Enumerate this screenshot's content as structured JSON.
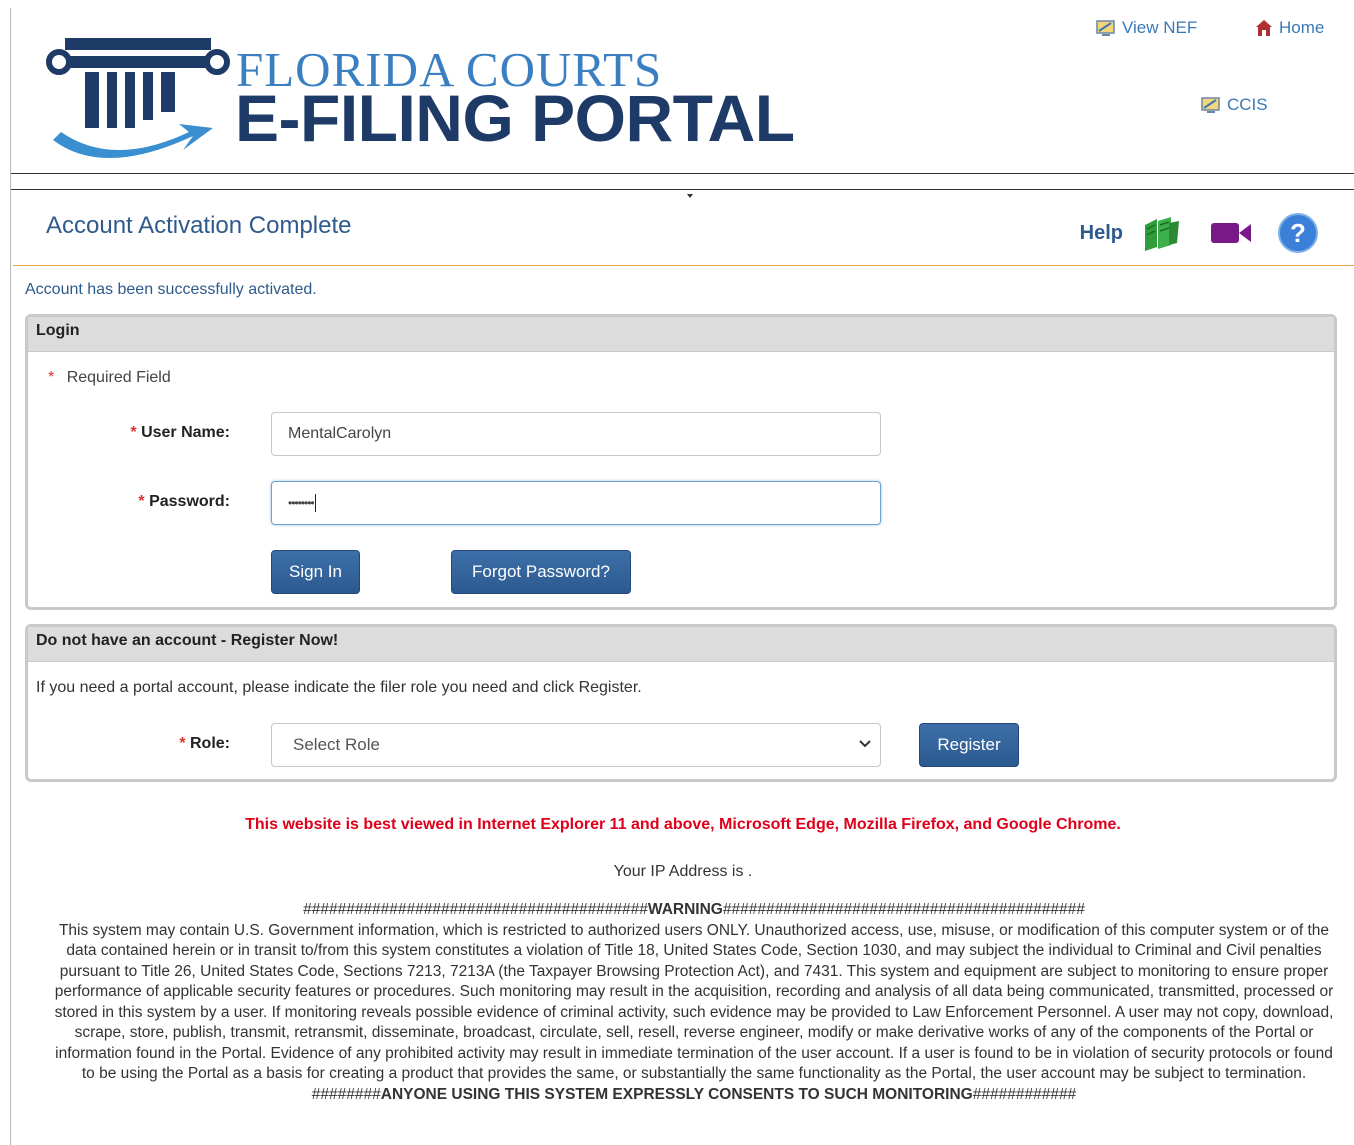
{
  "header": {
    "brand_line1": "FLORIDA COURTS",
    "brand_line2": "E-FILING PORTAL",
    "links": {
      "view_nef": "View NEF",
      "home": "Home",
      "ccis": "CCIS"
    }
  },
  "page": {
    "title": "Account Activation Complete",
    "help_label": "Help",
    "status_message": "Account has been successfully activated."
  },
  "login": {
    "heading": "Login",
    "required_marker": "*",
    "required_note": "Required Field",
    "username_label": "User Name:",
    "username_value": "MentalCarolyn",
    "password_label": "Password:",
    "password_value": "••••••••",
    "sign_in_label": "Sign In",
    "forgot_label": "Forgot Password?"
  },
  "register": {
    "heading": "Do not have an account - Register Now!",
    "instructions": "If you need a portal account, please indicate the filer role you need and click Register.",
    "role_label": "Role:",
    "role_selected": "Select Role",
    "register_label": "Register"
  },
  "footer": {
    "browser_note": "This website is best viewed in Internet Explorer 11 and above, Microsoft Edge, Mozilla Firefox, and Google Chrome.",
    "ip_line": "Your IP Address is .",
    "warning_title_left": "########################################",
    "warning_title_word": "WARNING",
    "warning_title_right": "##########################################",
    "warning_body": "This system may contain U.S. Government information, which is restricted to authorized users ONLY. Unauthorized access, use, misuse, or modification of this computer system or of the data contained herein or in transit to/from this system constitutes a violation of Title 18, United States Code, Section 1030, and may subject the individual to Criminal and Civil penalties pursuant to Title 26, United States Code, Sections 7213, 7213A (the Taxpayer Browsing Protection Act), and 7431. This system and equipment are subject to monitoring to ensure proper performance of applicable security features or procedures. Such monitoring may result in the acquisition, recording and analysis of all data being communicated, transmitted, processed or stored in this system by a user. If monitoring reveals possible evidence of criminal activity, such evidence may be provided to Law Enforcement Personnel. A user may not copy, download, scrape, store, publish, transmit, retransmit, disseminate, broadcast, circulate, sell, resell, reverse engineer, modify or make derivative works of any of the components of the Portal or information found in the Portal. Evidence of any prohibited activity may result in immediate termination of the user account. If a user is found to be in violation of security protocols or found to be using the Portal as a basis for creating a product that provides the same, or substantially the same functionality as the Portal, the user account may be subject to termination.",
    "warning_footer_left": "########",
    "warning_footer_word": "ANYONE USING THIS SYSTEM EXPRESSLY CONSENTS TO SUCH MONITORING",
    "warning_footer_right": "############"
  },
  "colors": {
    "brand_blue": "#3a7fc1",
    "brand_navy": "#1e3a66",
    "button_blue": "#2b5a8f",
    "title_rule": "#e8a54a",
    "required_red": "#d9342b",
    "browser_note_red": "#e0001b"
  }
}
